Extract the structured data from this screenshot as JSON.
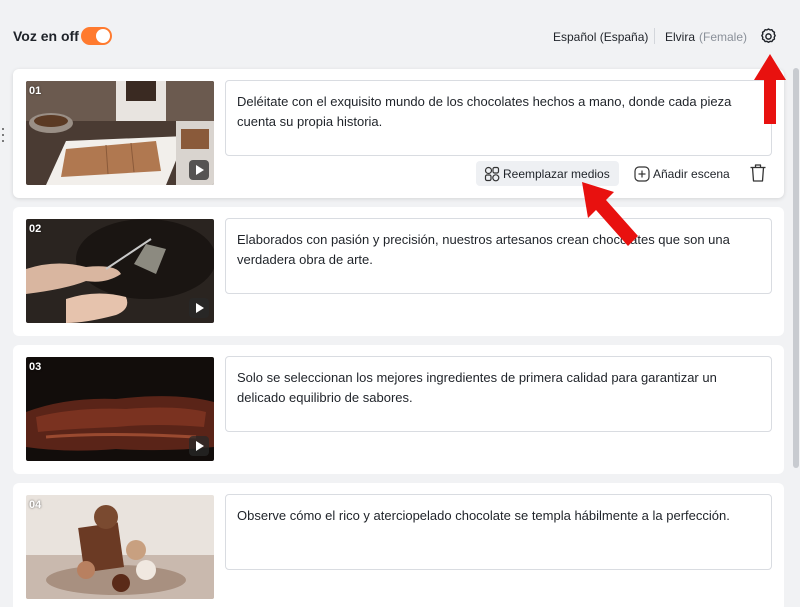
{
  "header": {
    "voice_toggle_label": "Voz en off",
    "voice_toggle_on": true,
    "language": "Español (España)",
    "voice_name": "Elvira",
    "voice_gender": "(Female)",
    "accent_color": "#ff7a2e"
  },
  "scenes": [
    {
      "number": "01",
      "text": "Deléitate con el exquisito mundo de los chocolates hechos a mano, donde cada pieza cuenta su propia historia.",
      "thumbnail": "chocolate-making-image"
    },
    {
      "number": "02",
      "text": "Elaborados con pasión y precisión, nuestros artesanos crean chocolates que son una verdadera obra de arte.",
      "thumbnail": "artisan-hands-image"
    },
    {
      "number": "03",
      "text": "Solo se seleccionan los mejores ingredientes de primera calidad para garantizar un delicado equilibrio de sabores.",
      "thumbnail": "grilled-meat-image"
    },
    {
      "number": "04",
      "text": "Observe cómo el rico y aterciopelado chocolate se templa hábilmente a la perfección.",
      "thumbnail": "chocolate-bonbons-image"
    }
  ],
  "scene_actions": {
    "replace_media": "Reemplazar medios",
    "add_scene": "Añadir escena"
  },
  "annotation_color": "#e8110f"
}
